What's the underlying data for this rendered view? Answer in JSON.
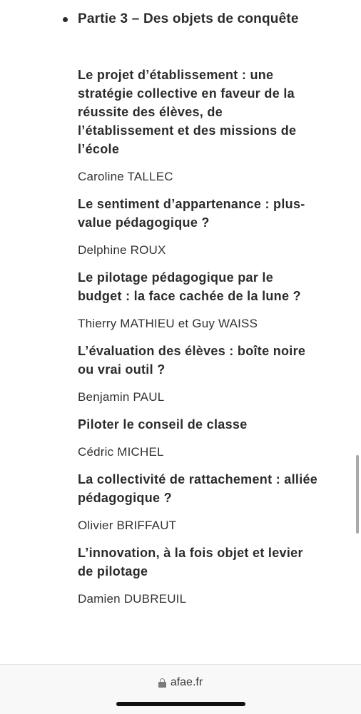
{
  "part_heading": "Partie 3 – Des objets de conquête",
  "articles": [
    {
      "title": "Le projet d’établissement : une stratégie collective en faveur de la réussite des élèves, de l’établissement et des missions de l’école",
      "author": "Caroline TALLEC"
    },
    {
      "title": "Le sentiment d’appartenance : plus-value pédagogique ?",
      "author": "Delphine ROUX"
    },
    {
      "title": "Le pilotage pédagogique par le budget : la face cachée de la lune ?",
      "author": "Thierry MATHIEU et Guy WAISS"
    },
    {
      "title": "L’évaluation des élèves : boîte noire ou vrai outil ?",
      "author": "Benjamin PAUL"
    },
    {
      "title": "Piloter le conseil de classe",
      "author": "Cédric MICHEL"
    },
    {
      "title": "La collectivité de rattachement : alliée pédagogique ?",
      "author": "Olivier BRIFFAUT"
    },
    {
      "title": "L’innovation, à la fois objet et levier de pilotage",
      "author": "Damien DUBREUIL"
    }
  ],
  "browser": {
    "address": "afae.fr",
    "lock_icon": "lock-icon"
  }
}
